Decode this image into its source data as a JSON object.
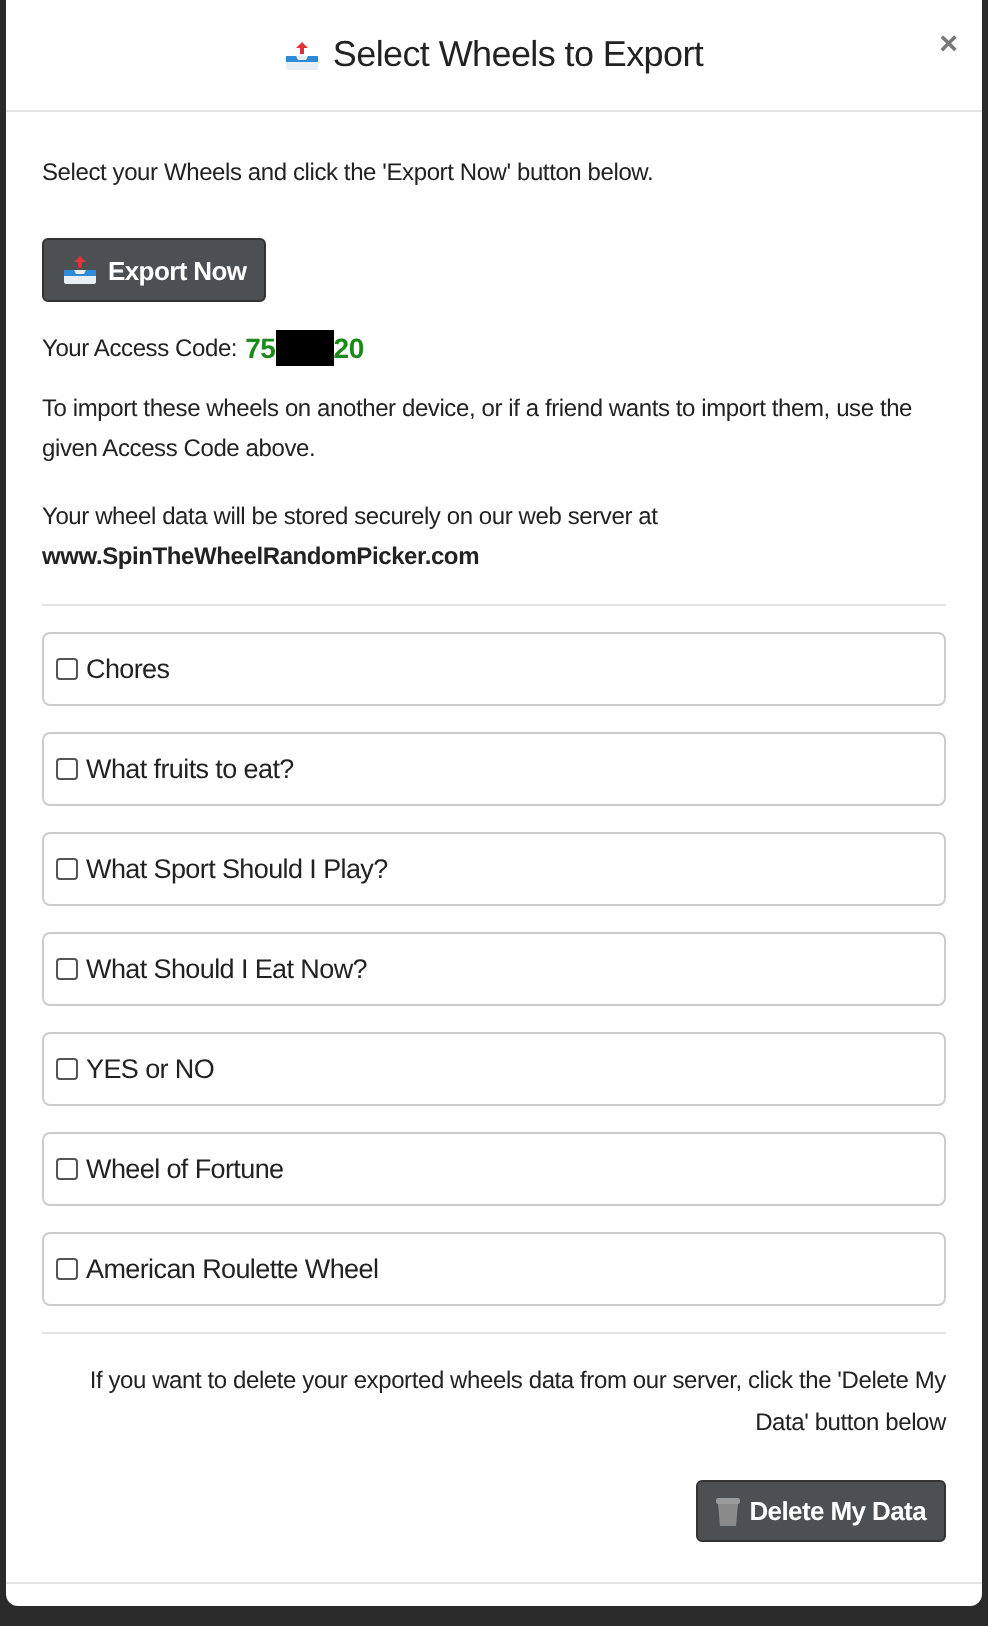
{
  "dialog": {
    "title": "Select Wheels to Export",
    "close": "×"
  },
  "intro": "Select your Wheels and click the 'Export Now' button below.",
  "export_button": {
    "label": "Export Now"
  },
  "access_code": {
    "label": "Your Access Code:",
    "visible_start": "75",
    "visible_end": "20",
    "redacted": true
  },
  "import_note": "To import these wheels on another device, or if a friend wants to import them, use the given Access Code above.",
  "storage_note": "Your wheel data will be stored securely on our web server at",
  "storage_site": "www.SpinTheWheelRandomPicker.com",
  "wheels": [
    {
      "label": "Chores",
      "checked": false
    },
    {
      "label": "What fruits to eat?",
      "checked": false
    },
    {
      "label": "What Sport Should I Play?",
      "checked": false
    },
    {
      "label": "What Should I Eat Now?",
      "checked": false
    },
    {
      "label": "YES or NO",
      "checked": false
    },
    {
      "label": "Wheel of Fortune",
      "checked": false
    },
    {
      "label": "American Roulette Wheel",
      "checked": false
    }
  ],
  "delete_note": "If you want to delete your exported wheels data from our server, click the 'Delete My Data' button below",
  "delete_button": {
    "label": "Delete My Data"
  }
}
